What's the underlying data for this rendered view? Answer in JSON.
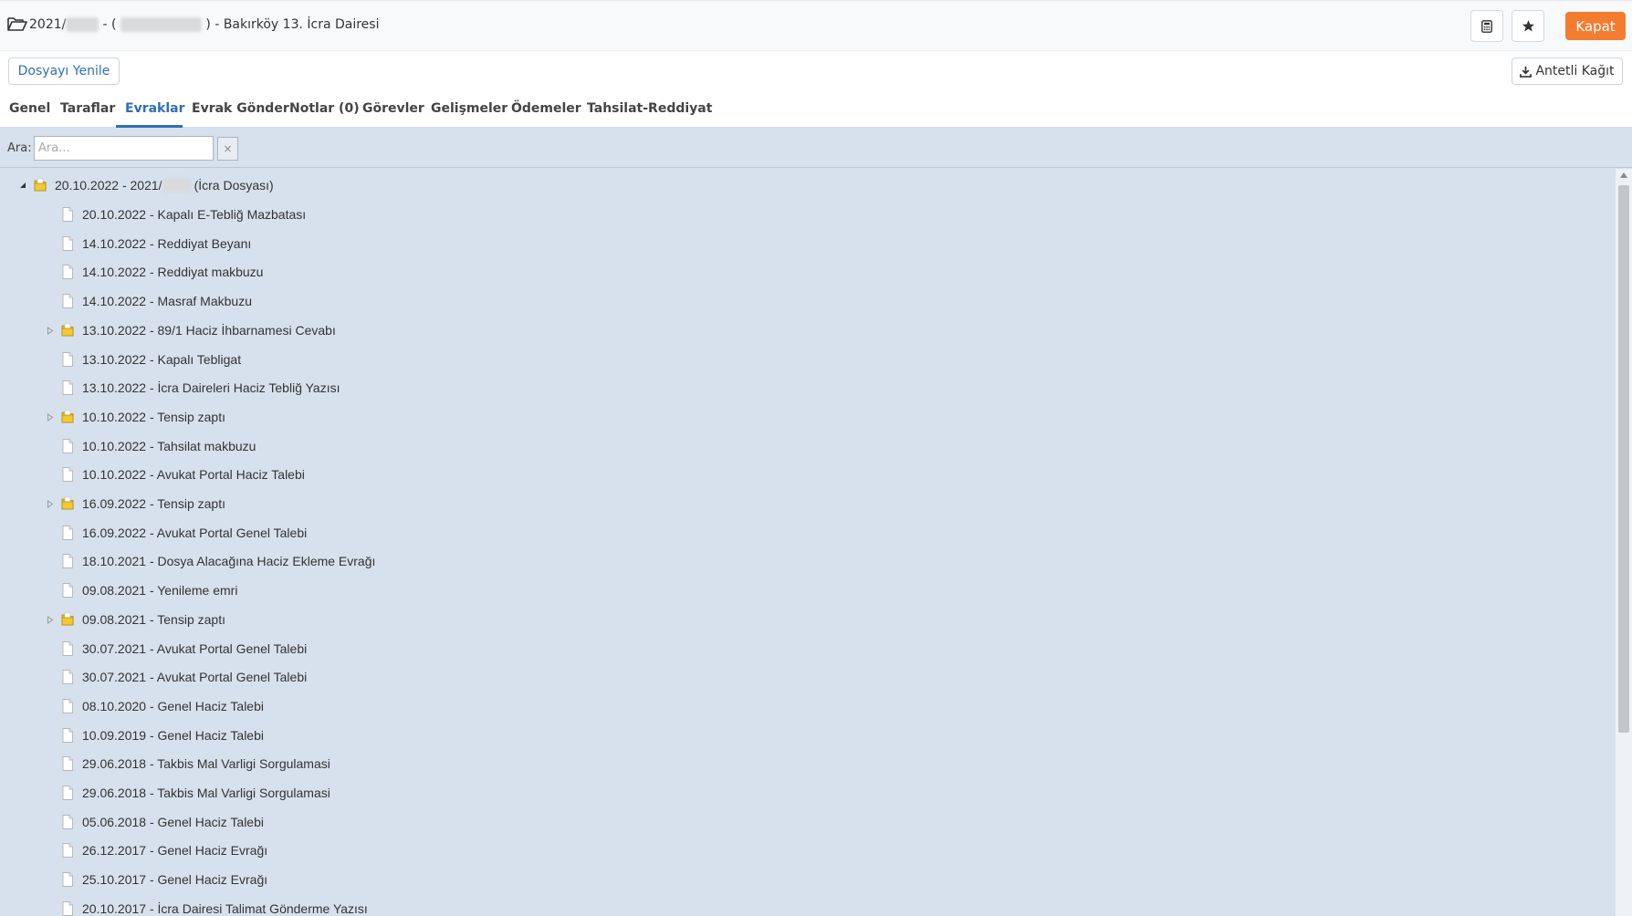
{
  "header": {
    "title_prefix": "2021/",
    "title_blur1": "9779",
    "title_mid": " - ( ",
    "title_blur2": "5591782688",
    "title_suffix": " ) - Bakırköy 13. İcra Dairesi",
    "close_label": "Kapat"
  },
  "toolbar": {
    "refresh_label": "Dosyayı Yenile",
    "letterhead_label": "Antetli Kağıt"
  },
  "tabs": [
    {
      "label": "Genel"
    },
    {
      "label": "Taraflar"
    },
    {
      "label": "Evraklar"
    },
    {
      "label": "Evrak Gönder"
    },
    {
      "label": "Notlar (0)"
    },
    {
      "label": "Görevler"
    },
    {
      "label": "Gelişmeler"
    },
    {
      "label": "Ödemeler"
    },
    {
      "label": "Tahsilat-Reddiyat"
    }
  ],
  "active_tab": "Evraklar",
  "search": {
    "label": "Ara:",
    "placeholder": "Ara...",
    "clear_label": "×"
  },
  "tree": {
    "root": {
      "label_prefix": "20.10.2022 - 2021/",
      "label_blur": "9779",
      "label_suffix": " (İcra Dosyası)"
    },
    "items": [
      {
        "label": "20.10.2022 - Kapalı E-Tebliğ Mazbatası",
        "type": "file"
      },
      {
        "label": "14.10.2022 - Reddiyat Beyanı",
        "type": "file"
      },
      {
        "label": "14.10.2022 - Reddiyat makbuzu",
        "type": "file"
      },
      {
        "label": "14.10.2022 - Masraf Makbuzu",
        "type": "file"
      },
      {
        "label": "13.10.2022 - 89/1 Haciz İhbarnamesi Cevabı",
        "type": "folder"
      },
      {
        "label": "13.10.2022 - Kapalı Tebligat",
        "type": "file"
      },
      {
        "label": "13.10.2022 - İcra Daireleri Haciz Tebliğ Yazısı",
        "type": "file"
      },
      {
        "label": "10.10.2022 - Tensip zaptı",
        "type": "folder"
      },
      {
        "label": "10.10.2022 - Tahsilat makbuzu",
        "type": "file"
      },
      {
        "label": "10.10.2022 - Avukat Portal Haciz Talebi",
        "type": "file"
      },
      {
        "label": "16.09.2022 - Tensip zaptı",
        "type": "folder"
      },
      {
        "label": "16.09.2022 - Avukat Portal Genel Talebi",
        "type": "file"
      },
      {
        "label": "18.10.2021 - Dosya Alacağına Haciz Ekleme Evrağı",
        "type": "file"
      },
      {
        "label": "09.08.2021 - Yenileme emri",
        "type": "file"
      },
      {
        "label": "09.08.2021 - Tensip zaptı",
        "type": "folder"
      },
      {
        "label": "30.07.2021 - Avukat Portal Genel Talebi",
        "type": "file"
      },
      {
        "label": "30.07.2021 - Avukat Portal Genel Talebi",
        "type": "file"
      },
      {
        "label": "08.10.2020 - Genel Haciz Talebi",
        "type": "file"
      },
      {
        "label": "10.09.2019 - Genel Haciz Talebi",
        "type": "file"
      },
      {
        "label": "29.06.2018 - Takbis Mal Varligi Sorgulamasi",
        "type": "file"
      },
      {
        "label": "29.06.2018 - Takbis Mal Varligi Sorgulamasi",
        "type": "file"
      },
      {
        "label": "05.06.2018 - Genel Haciz Talebi",
        "type": "file"
      },
      {
        "label": "26.12.2017 - Genel Haciz Evrağı",
        "type": "file"
      },
      {
        "label": "25.10.2017 - Genel Haciz Evrağı",
        "type": "file"
      },
      {
        "label": "20.10.2017 - İcra Dairesi Talimat Gönderme Yazısı",
        "type": "file"
      }
    ]
  },
  "colors": {
    "accent": "#2f6fb3",
    "close": "#f47c31",
    "tree_bg": "#d7e1ed",
    "folder": "#e8b820"
  },
  "icons": {
    "header": "folder-open-icon",
    "calculator": "calculator-icon",
    "star": "star-icon",
    "download": "download-icon",
    "folder": "folder-icon",
    "file": "file-icon"
  }
}
